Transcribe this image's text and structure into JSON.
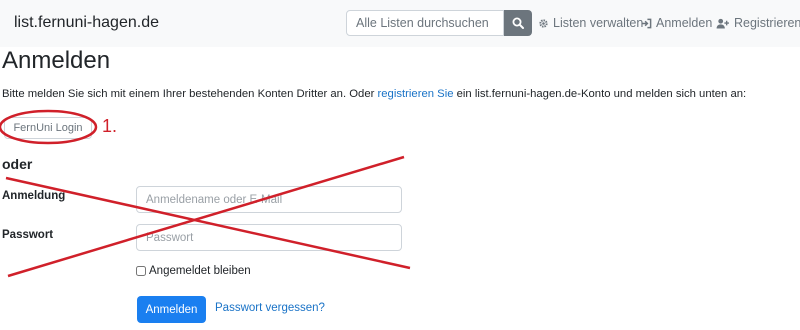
{
  "navbar": {
    "brand": "list.fernuni-hagen.de",
    "search_placeholder": "Alle Listen durchsuchen",
    "links": [
      {
        "label": "Listen verwalten",
        "icon": "gear-icon"
      },
      {
        "label": "Anmelden",
        "icon": "sign-in-icon"
      },
      {
        "label": "Registrieren",
        "icon": "user-plus-icon"
      }
    ]
  },
  "main": {
    "title": "Anmelden",
    "intro_before": "Bitte melden Sie sich mit einem Ihrer bestehenden Konten Dritter an. Oder ",
    "intro_link": "registrieren Sie",
    "intro_after": " ein list.fernuni-hagen.de-Konto und melden sich unten an:",
    "fernuni_button": "FernUni Login",
    "oder": "oder",
    "login_label": "Anmeldung",
    "login_placeholder": "Anmeldename oder E-Mail",
    "password_label": "Passwort",
    "password_placeholder": "Passwort",
    "remember": "Angemeldet bleiben",
    "submit": "Anmelden",
    "forgot": "Passwort vergessen?"
  },
  "annotation": {
    "step_label": "1.",
    "color": "#d0202a"
  }
}
